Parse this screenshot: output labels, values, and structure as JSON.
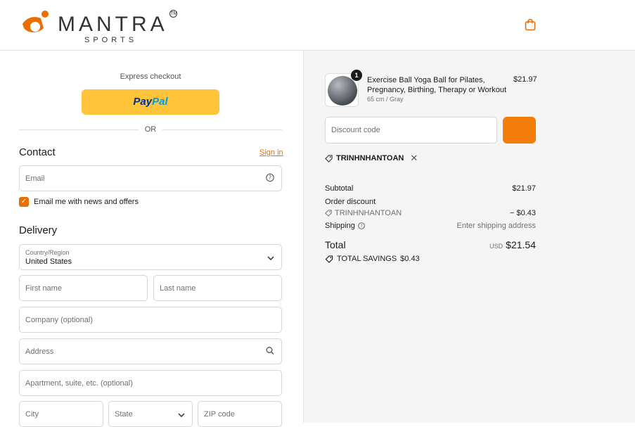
{
  "brand": {
    "name": "MANTRA",
    "sub": "SPORTS",
    "tm": "TM",
    "color": "#e86f00"
  },
  "header": {
    "cart_icon": "shopping-bag-icon"
  },
  "express": {
    "label": "Express checkout",
    "paypal_pay": "Pay",
    "paypal_pal": "Pal",
    "or": "OR"
  },
  "contact": {
    "title": "Contact",
    "signin": "Sign in",
    "email_placeholder": "Email",
    "newsletter_label": "Email me with news and offers",
    "newsletter_checked": true
  },
  "delivery": {
    "title": "Delivery",
    "country_label": "Country/Region",
    "country_value": "United States",
    "first_name": "First name",
    "last_name": "Last name",
    "company": "Company (optional)",
    "address": "Address",
    "apartment": "Apartment, suite, etc. (optional)",
    "city": "City",
    "state": "State",
    "zip": "ZIP code"
  },
  "summary": {
    "product": {
      "title": "Exercise Ball Yoga Ball for Pilates, Pregnancy, Birthing, Therapy or Workout",
      "variant": "65 cm / Gray",
      "price": "$21.97",
      "quantity": "1"
    },
    "discount_placeholder": "Discount code",
    "applied_code": "TRINHNHANTOAN",
    "subtotal_label": "Subtotal",
    "subtotal_value": "$21.97",
    "order_discount_label": "Order discount",
    "discount_code": "TRINHNHANTOAN",
    "discount_value": "− $0.43",
    "shipping_label": "Shipping",
    "shipping_value": "Enter shipping address",
    "total_label": "Total",
    "total_currency": "USD",
    "total_value": "$21.54",
    "savings_label": "TOTAL SAVINGS",
    "savings_value": "$0.43"
  },
  "colors": {
    "accent": "#e86f00",
    "apply_button": "#f47c0b",
    "paypal": "#ffc439"
  }
}
